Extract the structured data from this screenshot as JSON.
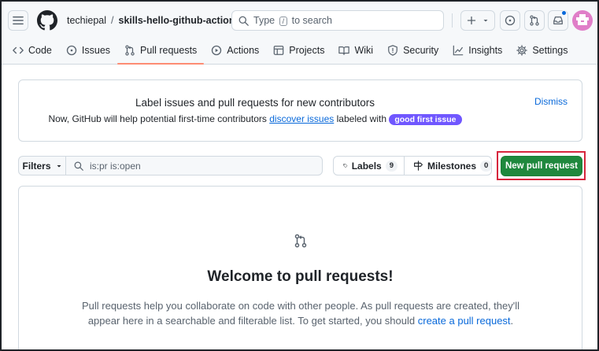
{
  "header": {
    "repo_owner": "techiepal",
    "separator": "/",
    "repo_name": "skills-hello-github-actions",
    "search_prefix": "Type",
    "search_key": "/",
    "search_suffix": "to search"
  },
  "tabs": [
    {
      "label": "Code",
      "icon": "code-icon"
    },
    {
      "label": "Issues",
      "icon": "issue-icon"
    },
    {
      "label": "Pull requests",
      "icon": "pull-request-icon",
      "active": true
    },
    {
      "label": "Actions",
      "icon": "play-icon"
    },
    {
      "label": "Projects",
      "icon": "table-icon"
    },
    {
      "label": "Wiki",
      "icon": "book-icon"
    },
    {
      "label": "Security",
      "icon": "shield-icon"
    },
    {
      "label": "Insights",
      "icon": "graph-icon"
    },
    {
      "label": "Settings",
      "icon": "gear-icon"
    }
  ],
  "banner": {
    "title": "Label issues and pull requests for new contributors",
    "text_before": "Now, GitHub will help potential first-time contributors",
    "link": "discover issues",
    "text_after": "labeled with",
    "label": "good first issue",
    "dismiss": "Dismiss"
  },
  "toolbar": {
    "filters_label": "Filters",
    "search_value": "is:pr is:open",
    "labels_label": "Labels",
    "labels_count": "9",
    "milestones_label": "Milestones",
    "milestones_count": "0",
    "new_pr_label": "New pull request"
  },
  "blankslate": {
    "title": "Welcome to pull requests!",
    "text": "Pull requests help you collaborate on code with other people. As pull requests are created, they'll appear here in a searchable and filterable list. To get started, you should",
    "link": "create a pull request",
    "end": "."
  },
  "colors": {
    "accent": "#0969da",
    "primary_button": "#1f883d",
    "label_purple": "#7057ff",
    "highlight_red": "#d7263d",
    "tab_underline": "#fd8c73"
  }
}
